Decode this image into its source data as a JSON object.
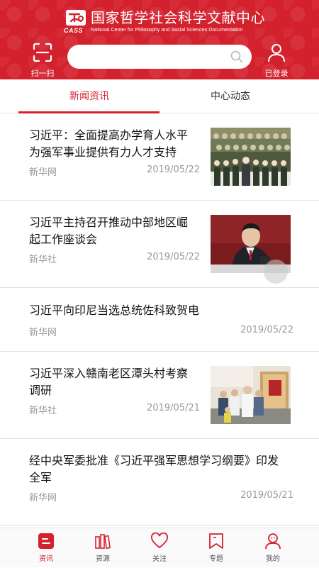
{
  "header": {
    "logo_text": "CASS",
    "title_cn": "国家哲学社会科学文献中心",
    "title_en": "National Center for Philosophy and Social Sciences Documentation",
    "scan_label": "扫一扫",
    "search_placeholder": "",
    "login_label": "已登录",
    "brand_color": "#d3212d"
  },
  "tabs": [
    {
      "label": "新闻资讯",
      "active": true
    },
    {
      "label": "中心动态",
      "active": false
    }
  ],
  "news": [
    {
      "title_line1": "习近平：全面提高办学育人水平",
      "title_line2": "为强军事业提供有力人才支持",
      "source": "新华网",
      "date": "2019/05/22",
      "has_image": true,
      "image": "military-group-photo"
    },
    {
      "title_line1": "习近平主持召开推动中部地区崛",
      "title_line2": "起工作座谈会",
      "source": "新华社",
      "date": "2019/05/22",
      "has_image": true,
      "image": "meeting-speaker-photo"
    },
    {
      "title_line1": "习近平向印尼当选总统佐科致贺电",
      "title_line2": "",
      "source": "新华网",
      "date": "2019/05/22",
      "has_image": false
    },
    {
      "title_line1": "习近平深入赣南老区潭头村考察",
      "title_line2": "调研",
      "source": "新华社",
      "date": "2019/05/21",
      "has_image": true,
      "image": "village-visit-photo"
    },
    {
      "title_line1": "经中央军委批准《习近平强军思想学习纲要》印发",
      "title_line2": "全军",
      "source": "新华网",
      "date": "2019/05/21",
      "has_image": false
    }
  ],
  "tabbar": [
    {
      "label": "资讯",
      "icon": "news-icon",
      "active": true
    },
    {
      "label": "资源",
      "icon": "books-icon",
      "active": false
    },
    {
      "label": "关注",
      "icon": "heart-icon",
      "active": false
    },
    {
      "label": "专题",
      "icon": "bookmark-icon",
      "active": false
    },
    {
      "label": "我的",
      "icon": "profile-icon",
      "active": false
    }
  ]
}
